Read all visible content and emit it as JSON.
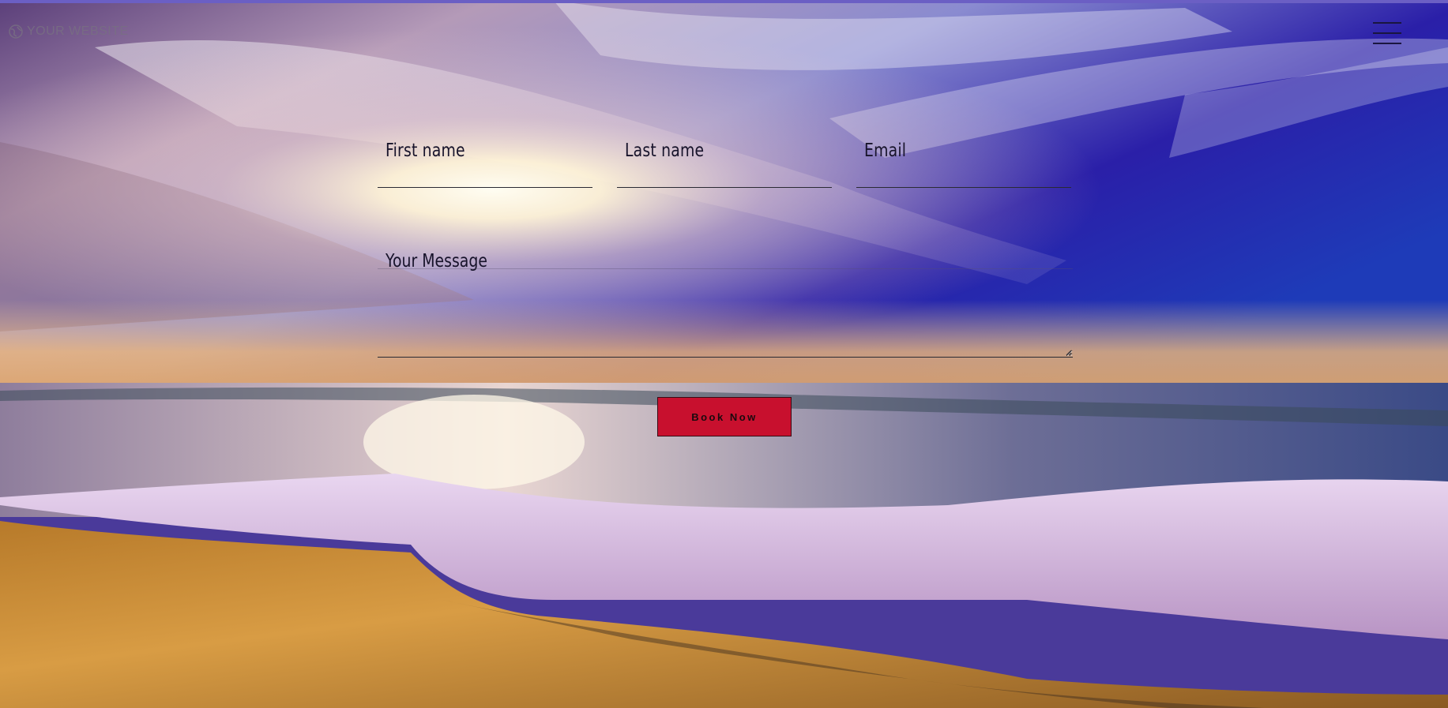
{
  "site": {
    "logo_text": "YOUR WEBSITE"
  },
  "header": {
    "menu_icon": "hamburger-menu-icon"
  },
  "form": {
    "first_name_label": "First name",
    "last_name_label": "Last name",
    "email_label": "Email",
    "message_label": "Your Message",
    "submit_label": "Book Now"
  },
  "colors": {
    "button_bg": "#c8102e",
    "label_text": "#17132a"
  }
}
